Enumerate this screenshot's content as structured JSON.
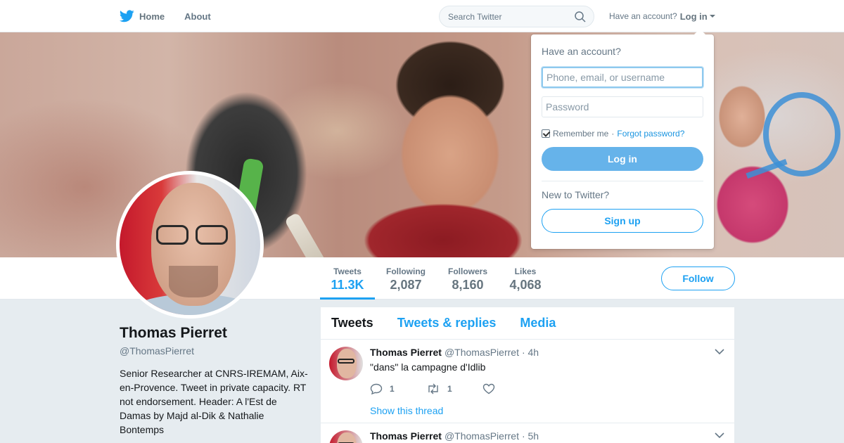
{
  "nav": {
    "home_label": "Home",
    "about_label": "About",
    "search_placeholder": "Search Twitter",
    "have_account": "Have an account?",
    "login_label": "Log in",
    "twitter_bird_icon": "twitter-bird-icon",
    "search_icon": "search-icon",
    "brand_color": "#1da1f2"
  },
  "profile": {
    "name": "Thomas Pierret",
    "handle": "@ThomasPierret",
    "bio": "Senior Researcher at CNRS-IREMAM, Aix-en-Provence. Tweet in private capacity. RT not endorsement. Header: A l'Est de Damas by Majd al-Dik & Nathalie Bontemps"
  },
  "stats": [
    {
      "label": "Tweets",
      "value": "11.3K"
    },
    {
      "label": "Following",
      "value": "2,087"
    },
    {
      "label": "Followers",
      "value": "8,160"
    },
    {
      "label": "Likes",
      "value": "4,068"
    }
  ],
  "follow_label": "Follow",
  "timeline": {
    "tabs": [
      "Tweets",
      "Tweets & replies",
      "Media"
    ],
    "tweets": [
      {
        "name": "Thomas Pierret",
        "handle": "@ThomasPierret",
        "time": "· 4h",
        "text": "\"dans\" la campagne d'Idlib",
        "replies": "1",
        "retweets": "1",
        "show_thread": "Show this thread"
      },
      {
        "name": "Thomas Pierret",
        "handle": "@ThomasPierret",
        "time": "· 5h"
      }
    ]
  },
  "login_dropdown": {
    "heading": "Have an account?",
    "username_placeholder": "Phone, email, or username",
    "password_placeholder": "Password",
    "remember_me": "Remember me",
    "separator": "·",
    "forgot_password": "Forgot password?",
    "login_button": "Log in",
    "new_to_twitter": "New to Twitter?",
    "signup_button": "Sign up"
  }
}
